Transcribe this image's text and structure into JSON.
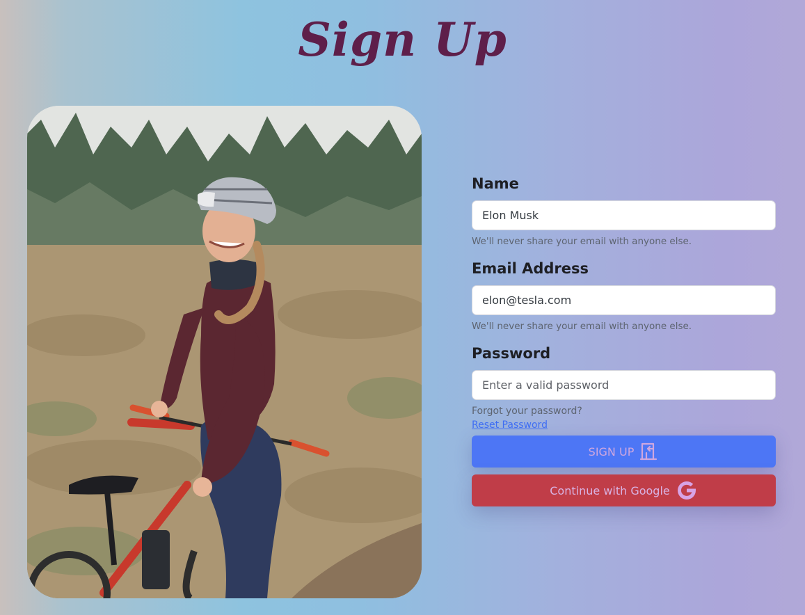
{
  "header": {
    "title": "Sign Up"
  },
  "hero": {
    "image_alt": "cyclist-photo"
  },
  "form": {
    "name": {
      "label": "Name",
      "value": "Elon Musk",
      "help": "We'll never share your email with anyone else."
    },
    "email": {
      "label": "Email Address",
      "value": "elon@tesla.com",
      "help": "We'll never share your email with anyone else."
    },
    "password": {
      "label": "Password",
      "placeholder": "Enter a valid password",
      "forgot_text": "Forgot your password?",
      "reset_link": "Reset Password"
    },
    "signup_button": {
      "label": "SIGN UP",
      "icon": "door-enter-icon"
    },
    "google_button": {
      "label": "Continue with Google",
      "icon": "google-icon"
    }
  },
  "colors": {
    "title": "#5e1f4a",
    "signup_bg": "#4d76f5",
    "google_bg": "#c03d48",
    "link": "#3f6ef3"
  }
}
